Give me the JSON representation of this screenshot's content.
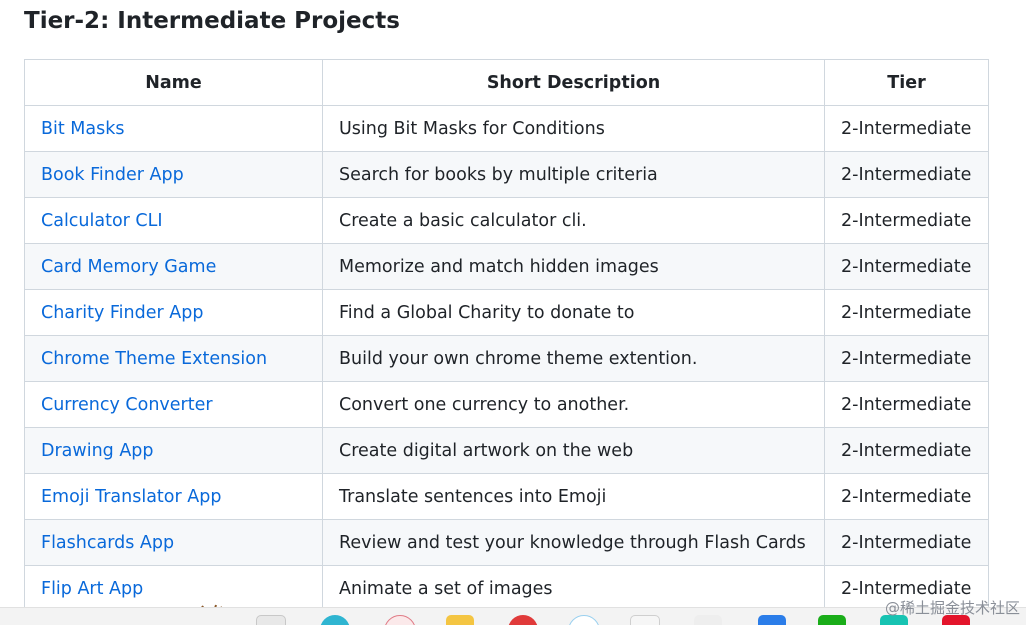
{
  "page": {
    "heading": "Tier-2: Intermediate Projects"
  },
  "table": {
    "headers": {
      "name": "Name",
      "description": "Short Description",
      "tier": "Tier"
    },
    "rows": [
      {
        "name": "Bit Masks",
        "description": "Using Bit Masks for Conditions",
        "tier": "2-Intermediate"
      },
      {
        "name": "Book Finder App",
        "description": "Search for books by multiple criteria",
        "tier": "2-Intermediate"
      },
      {
        "name": "Calculator CLI",
        "description": "Create a basic calculator cli.",
        "tier": "2-Intermediate"
      },
      {
        "name": "Card Memory Game",
        "description": "Memorize and match hidden images",
        "tier": "2-Intermediate"
      },
      {
        "name": "Charity Finder App",
        "description": "Find a Global Charity to donate to",
        "tier": "2-Intermediate"
      },
      {
        "name": "Chrome Theme Extension",
        "description": "Build your own chrome theme extention.",
        "tier": "2-Intermediate"
      },
      {
        "name": "Currency Converter",
        "description": "Convert one currency to another.",
        "tier": "2-Intermediate"
      },
      {
        "name": "Drawing App",
        "description": "Create digital artwork on the web",
        "tier": "2-Intermediate"
      },
      {
        "name": "Emoji Translator App",
        "description": "Translate sentences into Emoji",
        "tier": "2-Intermediate"
      },
      {
        "name": "Flashcards App",
        "description": "Review and test your knowledge through Flash Cards",
        "tier": "2-Intermediate"
      },
      {
        "name": "Flip Art App",
        "description": "Animate a set of images",
        "tier": "2-Intermediate"
      }
    ]
  },
  "watermark": "@稀土掘金技术社区",
  "colors": {
    "link": "#0969da",
    "border": "#d0d7de",
    "stripe": "#f6f8fa"
  }
}
